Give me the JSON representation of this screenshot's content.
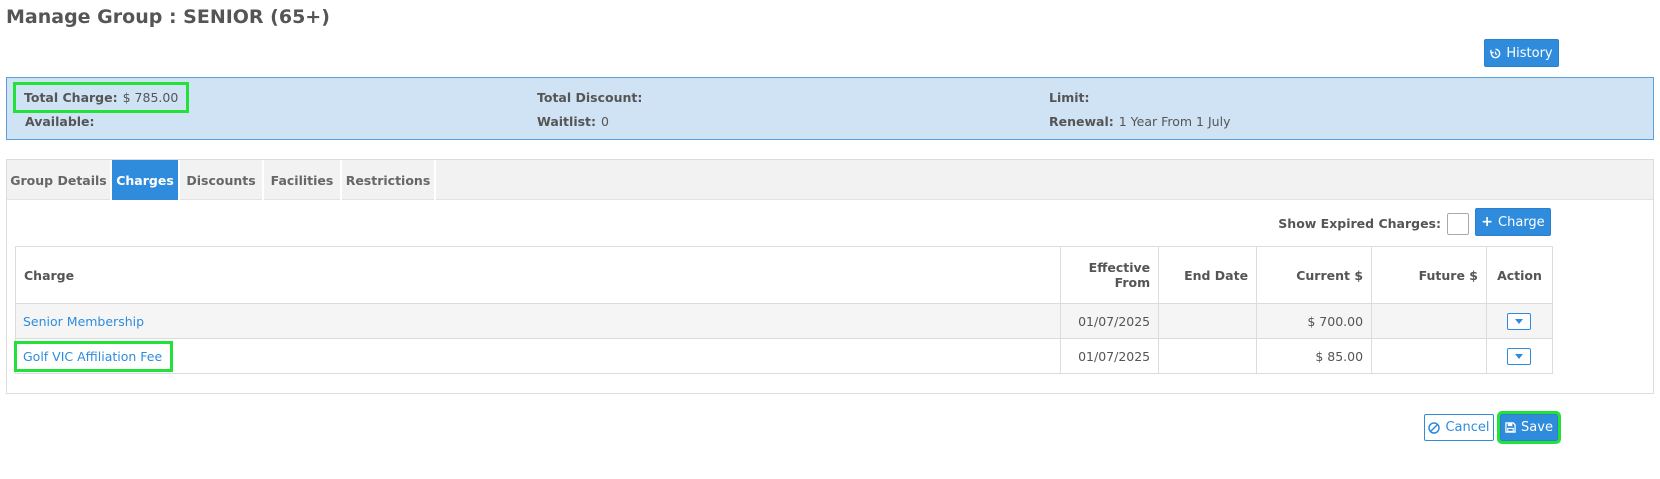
{
  "page": {
    "title": "Manage Group : SENIOR (65+)"
  },
  "header": {
    "history_label": "History",
    "history_icon": "history-icon"
  },
  "summary": {
    "total_charge_label": "Total Charge:",
    "total_charge_value": "$ 785.00",
    "total_discount_label": "Total Discount:",
    "total_discount_value": "",
    "limit_label": "Limit:",
    "limit_value": "",
    "available_label": "Available:",
    "available_value": "",
    "waitlist_label": "Waitlist:",
    "waitlist_value": "0",
    "renewal_label": "Renewal:",
    "renewal_value": "1 Year From 1 July"
  },
  "tabs": [
    {
      "label": "Group Details",
      "active": false
    },
    {
      "label": "Charges",
      "active": true
    },
    {
      "label": "Discounts",
      "active": false
    },
    {
      "label": "Facilities",
      "active": false
    },
    {
      "label": "Restrictions",
      "active": false
    }
  ],
  "charges": {
    "show_expired_label": "Show Expired Charges:",
    "add_charge_label": "Charge",
    "columns": {
      "charge": "Charge",
      "effective_from": "Effective From",
      "end_date": "End Date",
      "current": "Current $",
      "future": "Future $",
      "action": "Action"
    },
    "rows": [
      {
        "charge": "Senior Membership",
        "effective_from": "01/07/2025",
        "end_date": "",
        "current": "$ 700.00",
        "future": ""
      },
      {
        "charge": "Golf VIC Affiliation Fee",
        "effective_from": "01/07/2025",
        "end_date": "",
        "current": "$ 85.00",
        "future": ""
      }
    ]
  },
  "footer": {
    "cancel_label": "Cancel",
    "save_label": "Save"
  },
  "colors": {
    "accent": "#2f8cdc",
    "summary_bg": "#cfe3f5",
    "highlight": "#22e23a"
  }
}
